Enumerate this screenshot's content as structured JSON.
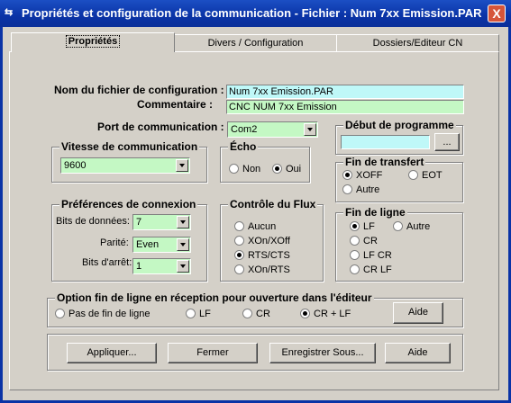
{
  "window": {
    "title": "Propriétés et configuration de la communication - Fichier : Num 7xx Emission.PAR",
    "icon": "communication-icon",
    "close_label": "X"
  },
  "tabs": [
    {
      "label": "Propriétés",
      "active": true
    },
    {
      "label": "Divers / Configuration",
      "active": false
    },
    {
      "label": "Dossiers/Editeur CN",
      "active": false
    }
  ],
  "config_file": {
    "label": "Nom du fichier de configuration :",
    "value": "Num 7xx Emission.PAR"
  },
  "comment": {
    "label": "Commentaire :",
    "value": "CNC NUM 7xx Emission"
  },
  "port": {
    "label": "Port de communication :",
    "value": "Com2"
  },
  "speed": {
    "title": "Vitesse de communication",
    "value": "9600"
  },
  "echo": {
    "title": "Écho",
    "options": [
      "Non",
      "Oui"
    ],
    "selected": "Oui"
  },
  "program_start": {
    "title": "Début de programme",
    "value": "",
    "browse_label": "..."
  },
  "transfer_end": {
    "title": "Fin de transfert",
    "options": [
      "XOFF",
      "EOT",
      "Autre"
    ],
    "selected": "XOFF"
  },
  "connection": {
    "title": "Préférences de connexion",
    "data_bits": {
      "label": "Bits de données:",
      "value": "7"
    },
    "parity": {
      "label": "Parité:",
      "value": "Even"
    },
    "stop_bits": {
      "label": "Bits d'arrêt:",
      "value": "1"
    }
  },
  "flow_control": {
    "title": "Contrôle du Flux",
    "options": [
      "Aucun",
      "XOn/XOff",
      "RTS/CTS",
      "XOn/RTS"
    ],
    "selected": "RTS/CTS"
  },
  "line_end": {
    "title": "Fin de ligne",
    "options": [
      "LF",
      "Autre",
      "CR",
      "LF CR",
      "CR LF"
    ],
    "selected": "LF"
  },
  "rx_line_end": {
    "title": "Option fin de ligne en réception pour ouverture dans l'éditeur",
    "options": [
      "Pas de fin de ligne",
      "LF",
      "CR",
      "CR + LF"
    ],
    "selected": "CR + LF",
    "help_label": "Aide"
  },
  "buttons": {
    "apply": "Appliquer...",
    "close": "Fermer",
    "save_as": "Enregistrer Sous...",
    "help": "Aide"
  },
  "colors": {
    "title_bar": "#0a33a6",
    "field_cyan": "#bff8f8",
    "field_green": "#c4f8c4",
    "face": "#d4d0c8"
  }
}
